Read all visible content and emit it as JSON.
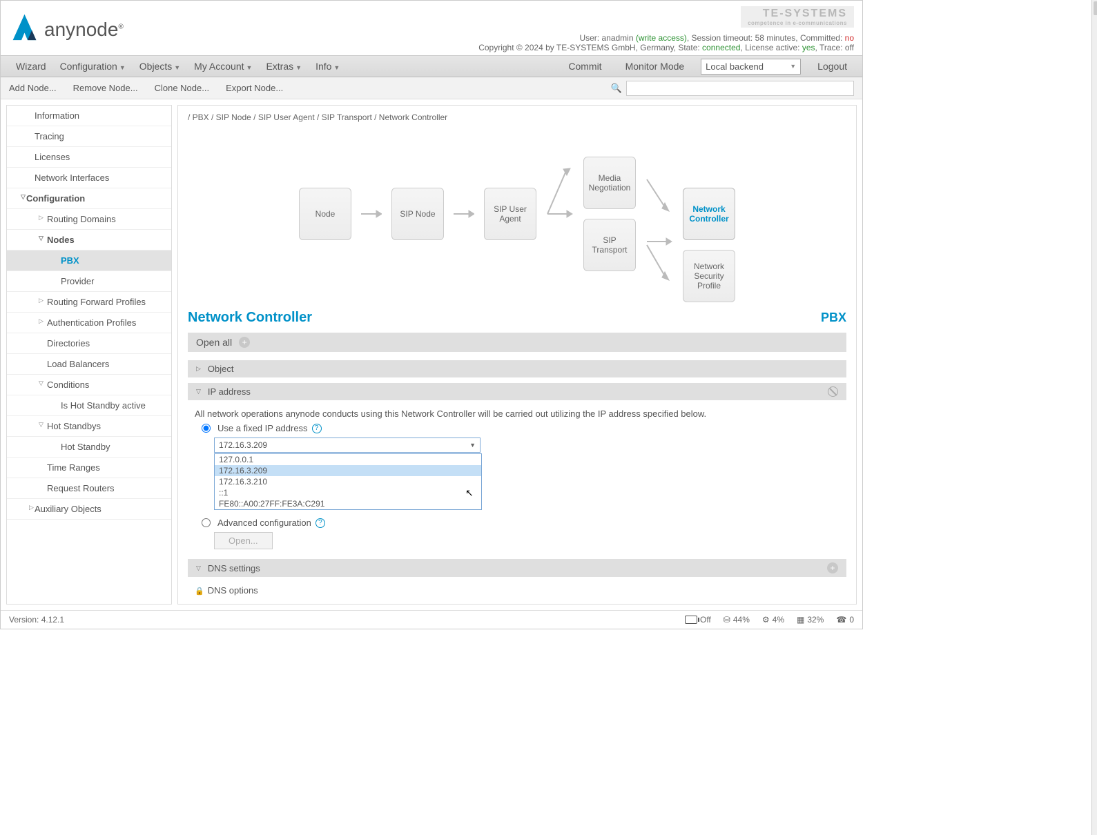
{
  "header": {
    "brand": "anynode",
    "te_logo": "TE-SYSTEMS",
    "te_sub": "competence in e-communications",
    "user_prefix": "User: ",
    "user": "anadmin",
    "access": " (write access)",
    "session_label": ", Session timeout: ",
    "session": "58 minutes",
    "committed_label": ", Committed: ",
    "committed": "no",
    "copyright": "Copyright © 2024 by TE-SYSTEMS GmbH, Germany, State: ",
    "state": "connected",
    "license_label": ", License active: ",
    "license": "yes",
    "trace_label": ", Trace: ",
    "trace": "off"
  },
  "menubar": {
    "items": [
      "Wizard",
      "Configuration",
      "Objects",
      "My Account",
      "Extras",
      "Info"
    ],
    "commit": "Commit",
    "monitor": "Monitor Mode",
    "backend": "Local backend",
    "logout": "Logout"
  },
  "toolbar": {
    "add": "Add Node...",
    "remove": "Remove Node...",
    "clone": "Clone Node...",
    "export": "Export Node..."
  },
  "sidebar": {
    "items": [
      {
        "label": "Information",
        "lvl": "l1"
      },
      {
        "label": "Tracing",
        "lvl": "l1"
      },
      {
        "label": "Licenses",
        "lvl": "l1"
      },
      {
        "label": "Network Interfaces",
        "lvl": "l1"
      },
      {
        "label": "Configuration",
        "lvl": "l0",
        "bold": true,
        "exp": "▽"
      },
      {
        "label": "Routing Domains",
        "lvl": "l2",
        "exp": "▷"
      },
      {
        "label": "Nodes",
        "lvl": "l2",
        "bold": true,
        "exp": "▽"
      },
      {
        "label": "PBX",
        "lvl": "l3",
        "active": true
      },
      {
        "label": "Provider",
        "lvl": "l3"
      },
      {
        "label": "Routing Forward Profiles",
        "lvl": "l2",
        "exp": "▷"
      },
      {
        "label": "Authentication Profiles",
        "lvl": "l2",
        "exp": "▷"
      },
      {
        "label": "Directories",
        "lvl": "l2"
      },
      {
        "label": "Load Balancers",
        "lvl": "l2"
      },
      {
        "label": "Conditions",
        "lvl": "l2",
        "exp": "▽"
      },
      {
        "label": "Is Hot Standby active",
        "lvl": "l3"
      },
      {
        "label": "Hot Standbys",
        "lvl": "l2",
        "exp": "▽"
      },
      {
        "label": "Hot Standby",
        "lvl": "l3"
      },
      {
        "label": "Time Ranges",
        "lvl": "l2"
      },
      {
        "label": "Request Routers",
        "lvl": "l2"
      },
      {
        "label": "Auxiliary Objects",
        "lvl": "l1",
        "exp": "▷"
      }
    ]
  },
  "breadcrumb": "/ PBX / SIP Node / SIP User Agent / SIP Transport / Network Controller",
  "diagram": {
    "node": "Node",
    "sipnode": "SIP Node",
    "sipua": "SIP User Agent",
    "media": "Media Negotiation",
    "siptrans": "SIP Transport",
    "netctrl": "Network Controller",
    "netsec": "Network Security Profile"
  },
  "page": {
    "title": "Network Controller",
    "sub": "PBX"
  },
  "openall": "Open all",
  "sections": {
    "object": "Object",
    "ip": {
      "title": "IP address",
      "desc": "All network operations anynode conducts using this Network Controller will be carried out utilizing the IP address specified below.",
      "fixed": "Use a fixed IP address",
      "selected": "172.16.3.209",
      "options": [
        "127.0.0.1",
        "172.16.3.209",
        "172.16.3.210",
        "::1",
        "FE80::A00:27FF:FE3A:C291"
      ],
      "advanced": "Advanced configuration",
      "open": "Open..."
    },
    "dns": "DNS settings",
    "dnsopt": "DNS options"
  },
  "footer": {
    "version_label": "Version: ",
    "version": "4.12.1",
    "off": "Off",
    "p44": "44%",
    "p4": "4%",
    "p32": "32%",
    "p0": "0"
  }
}
